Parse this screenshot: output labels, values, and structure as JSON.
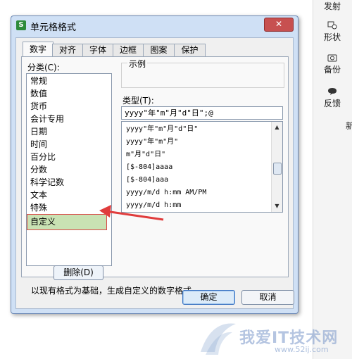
{
  "sidebar": {
    "items": [
      {
        "label": "发射",
        "icon": "send-icon"
      },
      {
        "label": "形状",
        "icon": "shape-icon"
      },
      {
        "label": "备份",
        "icon": "backup-icon"
      },
      {
        "label": "反馈",
        "icon": "feedback-icon"
      }
    ],
    "edge_text": "新"
  },
  "dialog": {
    "title": "单元格格式",
    "app_icon": "S",
    "close_label": "✕",
    "tabs": [
      "数字",
      "对齐",
      "字体",
      "边框",
      "图案",
      "保护"
    ],
    "active_tab": "数字",
    "category_label": "分类(C):",
    "categories": [
      "常规",
      "数值",
      "货币",
      "会计专用",
      "日期",
      "时间",
      "百分比",
      "分数",
      "科学记数",
      "文本",
      "特殊",
      "自定义"
    ],
    "selected_category": "自定义",
    "preview_label": "示例",
    "type_label": "类型(T):",
    "type_value": "yyyy\"年\"m\"月\"d\"日\";@",
    "formats": [
      "yyyy\"年\"m\"月\"d\"日\"",
      "yyyy\"年\"m\"月\"",
      "m\"月\"d\"日\"",
      "[$-804]aaaa",
      "[$-804]aaa",
      "yyyy/m/d h:mm AM/PM",
      "yyyy/m/d h:mm"
    ],
    "delete_label": "删除(D)",
    "description": "以现有格式为基础，生成自定义的数字格式。",
    "ok_label": "确定",
    "cancel_label": "取消"
  },
  "watermark": {
    "text": "我爱IT技术网",
    "url": "www.52ij.com"
  },
  "colors": {
    "accent": "#3e76c3",
    "highlight": "#c9e2b3",
    "arrow": "#e03c3c",
    "sheet_line": "#2e9a2e"
  }
}
